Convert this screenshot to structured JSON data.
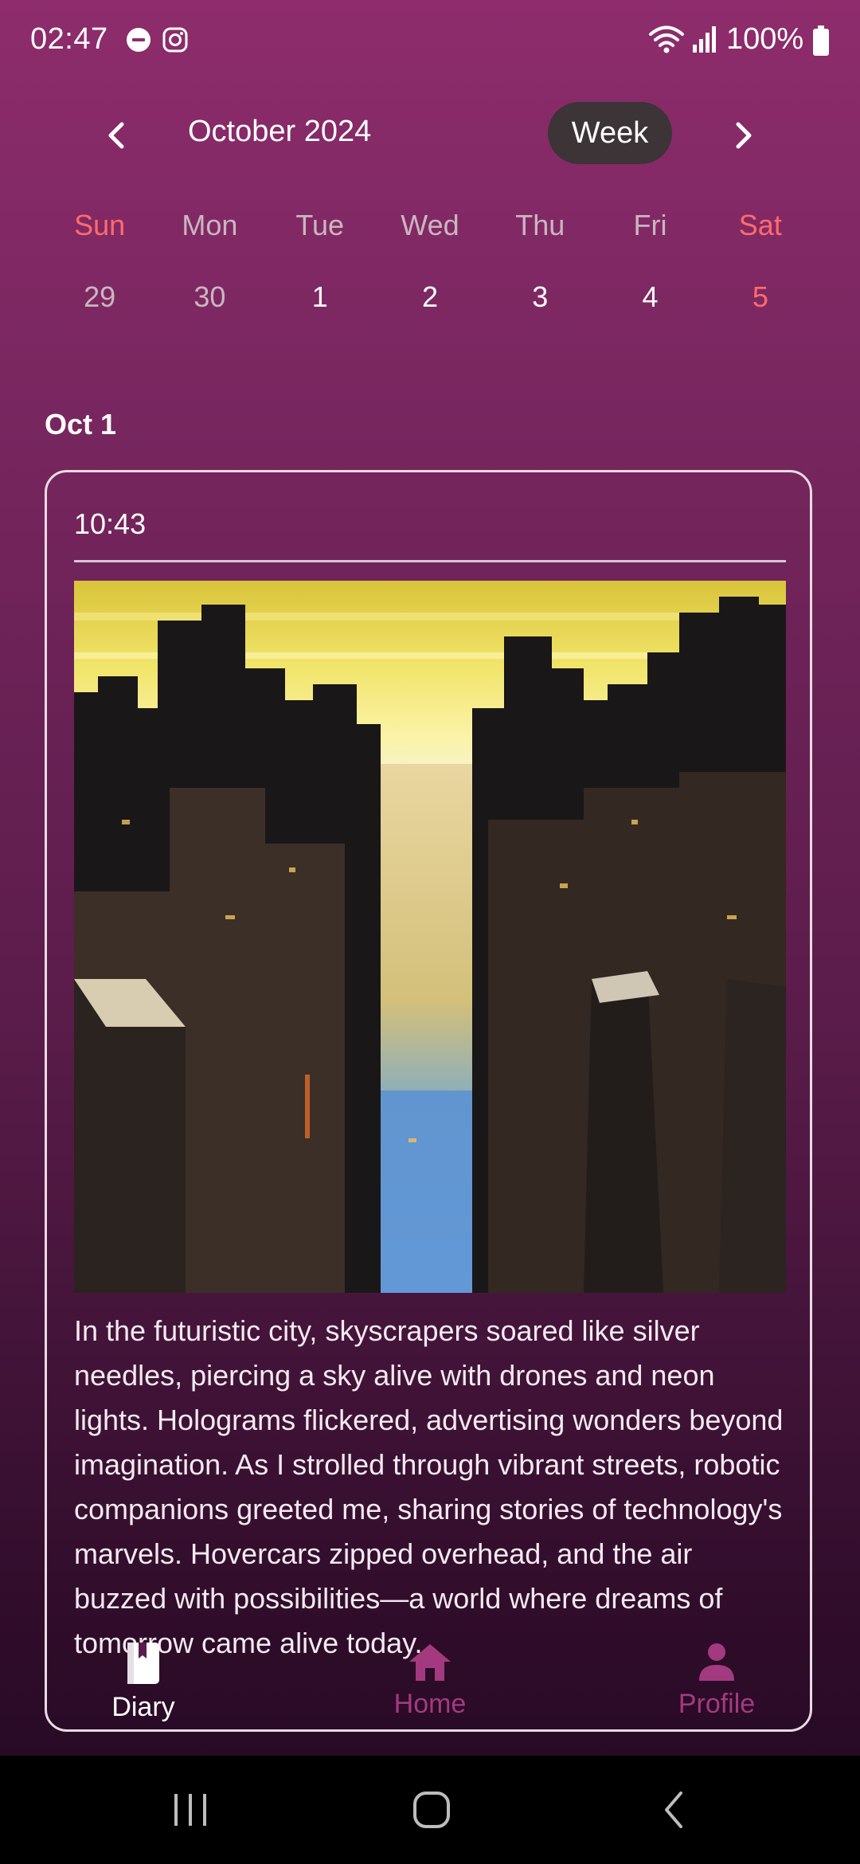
{
  "status_bar": {
    "time": "02:47",
    "battery": "100%",
    "icons": [
      "do-not-disturb-icon",
      "instagram-icon",
      "wifi-icon",
      "signal-icon",
      "battery-icon"
    ]
  },
  "calendar": {
    "month_title": "October 2024",
    "view_toggle": "Week",
    "prev_icon": "chevron-left-icon",
    "next_icon": "chevron-right-icon",
    "days_of_week": [
      "Sun",
      "Mon",
      "Tue",
      "Wed",
      "Thu",
      "Fri",
      "Sat"
    ],
    "dates": [
      "29",
      "30",
      "1",
      "2",
      "3",
      "4",
      "5"
    ]
  },
  "section": {
    "label": "Oct 1"
  },
  "entry": {
    "time": "10:43",
    "text": "In the futuristic city, skyscrapers soared like silver needles, piercing a sky alive with drones and neon lights. Holograms flickered, advertising wonders beyond imagination. As I strolled through vibrant streets, robotic companions greeted me, sharing stories of technology's marvels. Hovercars zipped overhead, and the air buzzed with possibilities—a world where dreams of tomorrow came alive today."
  },
  "bottom_nav": {
    "diary": "Diary",
    "home": "Home",
    "profile": "Profile"
  },
  "colors": {
    "weekend": "#ff6b6b",
    "accent": "#a33a7f",
    "pill": "#3c3437"
  }
}
